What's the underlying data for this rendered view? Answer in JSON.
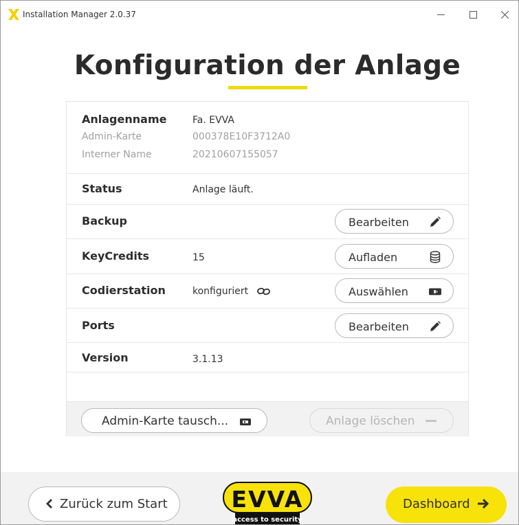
{
  "window": {
    "title": "Installation Manager 2.0.37"
  },
  "page": {
    "title": "Konfiguration der Anlage",
    "accent_color": "#f0d90a"
  },
  "details": {
    "plant_name_label": "Anlagenname",
    "plant_name_value": "Fa. EVVA",
    "admin_card_label": "Admin-Karte",
    "admin_card_value": "000378E10F3712A0",
    "internal_name_label": "Interner Name",
    "internal_name_value": "20210607155057",
    "status_label": "Status",
    "status_value": "Anlage läuft.",
    "backup_label": "Backup",
    "backup_button": "Bearbeiten",
    "keycredits_label": "KeyCredits",
    "keycredits_value": "15",
    "keycredits_button": "Aufladen",
    "codierstation_label": "Codierstation",
    "codierstation_value": "konfiguriert",
    "codierstation_button": "Auswählen",
    "ports_label": "Ports",
    "ports_button": "Bearbeiten",
    "version_label": "Version",
    "version_value": "3.1.13"
  },
  "panel_footer": {
    "swap_admin_card_button": "Admin-Karte tausch...",
    "delete_plant_button": "Anlage löschen"
  },
  "bottom_nav": {
    "back_button": "Zurück zum Start",
    "dashboard_button": "Dashboard",
    "logo_text": "EVVA",
    "logo_tagline": "access to security",
    "primary_color": "#f7e20a"
  }
}
